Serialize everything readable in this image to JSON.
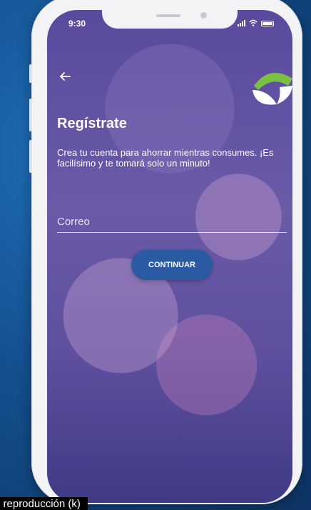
{
  "status_bar": {
    "time": "9:30"
  },
  "screen": {
    "back_icon": "arrow-left-icon",
    "title": "Regístrate",
    "description": "Crea tu cuenta para ahorrar mientras consumes. ¡Es facilísimo y te tomará solo un minuto!",
    "email_field": {
      "placeholder": "Correo",
      "value": ""
    },
    "continue_label": "CONTINUAR"
  },
  "video_caption": "e reproducción (k)",
  "colors": {
    "background": "#14508f",
    "overlay": "#5a4a9e",
    "button": "#2a5aa2",
    "logo_green": "#7ac143",
    "text": "#ffffff"
  }
}
